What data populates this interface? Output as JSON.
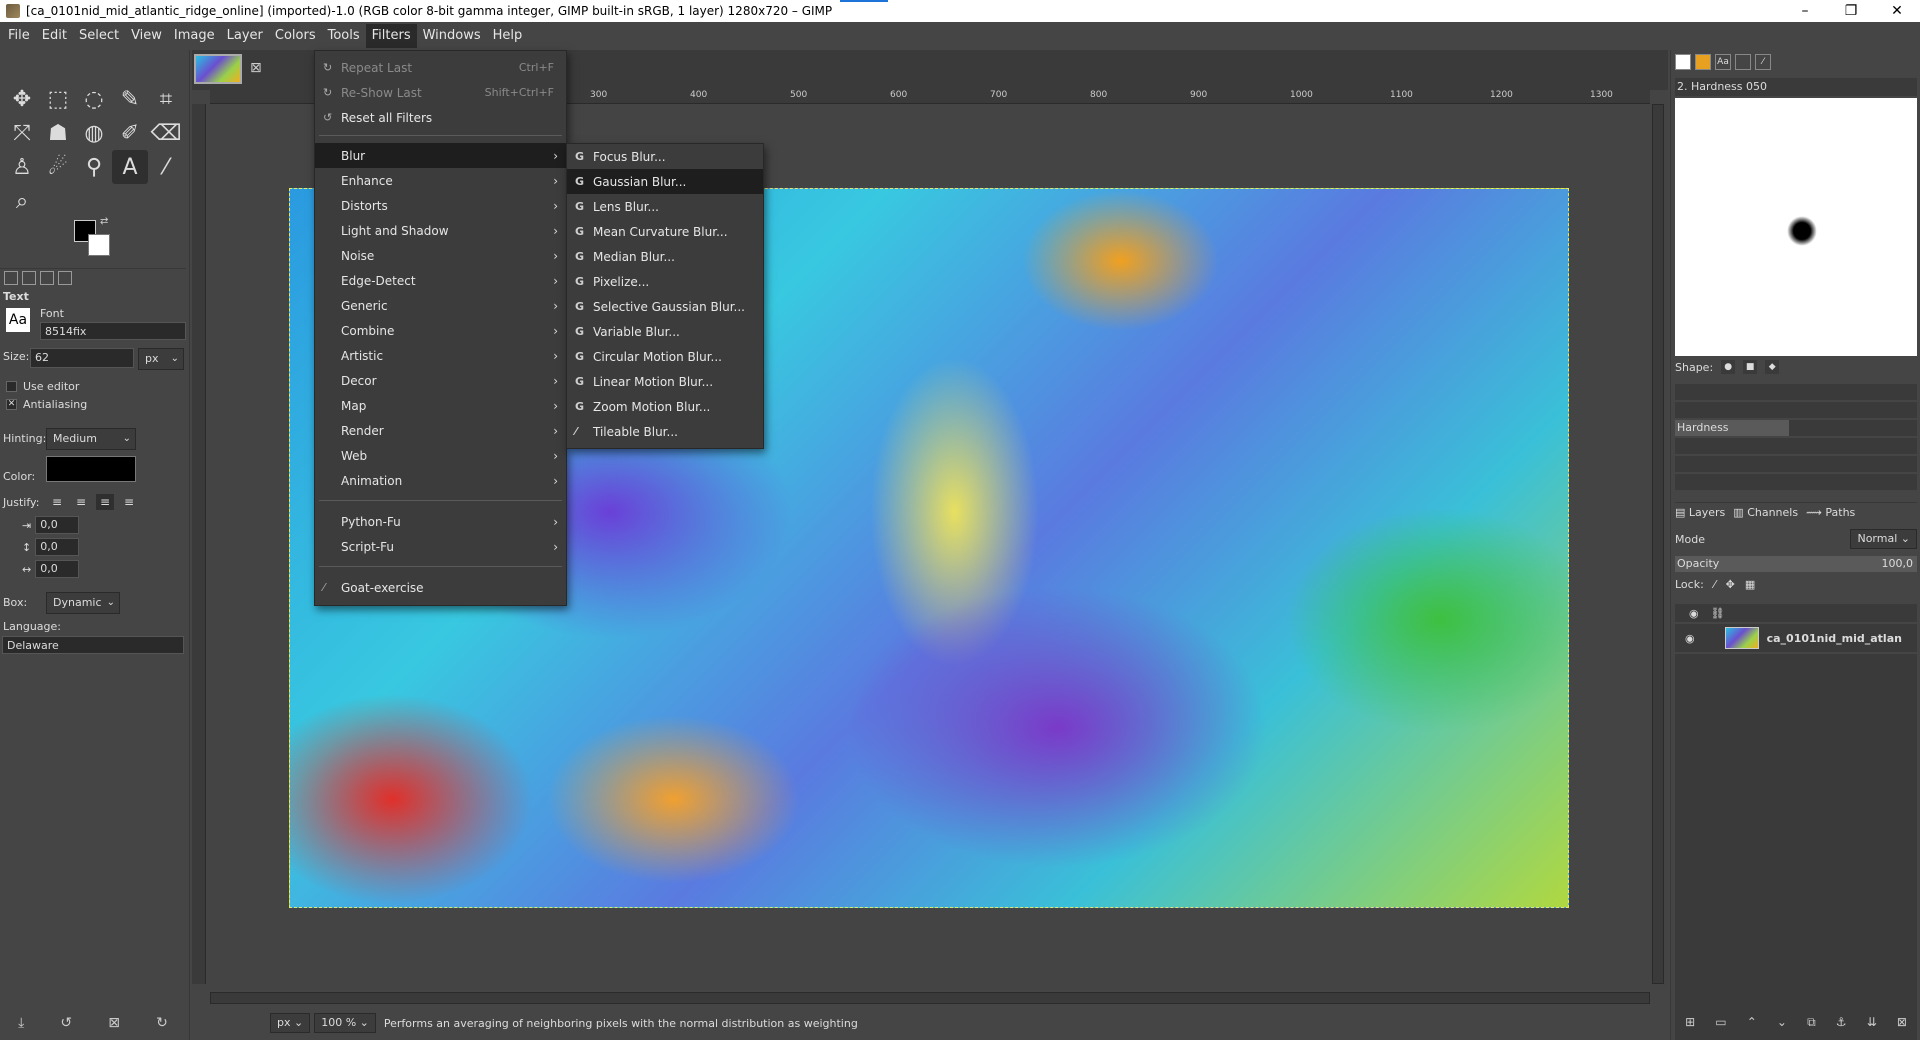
{
  "window": {
    "title": "[ca_0101nid_mid_atlantic_ridge_online] (imported)-1.0 (RGB color 8-bit gamma integer, GIMP built-in sRGB, 1 layer) 1280x720 – GIMP",
    "controls": [
      "–",
      "❐",
      "✕"
    ]
  },
  "menubar": [
    "File",
    "Edit",
    "Select",
    "View",
    "Image",
    "Layer",
    "Colors",
    "Tools",
    "Filters",
    "Windows",
    "Help"
  ],
  "filters_menu": {
    "repeat_last": {
      "label": "Repeat Last",
      "accel": "Ctrl+F"
    },
    "reshow_last": {
      "label": "Re-Show Last",
      "accel": "Shift+Ctrl+F"
    },
    "reset_all": {
      "label": "Reset all Filters"
    },
    "groups": [
      "Blur",
      "Enhance",
      "Distorts",
      "Light and Shadow",
      "Noise",
      "Edge-Detect",
      "Generic",
      "Combine",
      "Artistic",
      "Decor",
      "Map",
      "Render",
      "Web",
      "Animation"
    ],
    "scripts": [
      "Python-Fu",
      "Script-Fu"
    ],
    "goat": "Goat-exercise"
  },
  "blur_menu": [
    "Focus Blur...",
    "Gaussian Blur...",
    "Lens Blur...",
    "Mean Curvature Blur...",
    "Median Blur...",
    "Pixelize...",
    "Selective Gaussian Blur...",
    "Variable Blur...",
    "Circular Motion Blur...",
    "Linear Motion Blur...",
    "Zoom Motion Blur...",
    "Tileable Blur..."
  ],
  "tool_options": {
    "section": "Text",
    "font_label": "Font",
    "font_value": "8514fix",
    "size_label": "Size:",
    "size_value": "62",
    "size_unit": "px",
    "use_editor": "Use editor",
    "antialiasing": "Antialiasing",
    "hinting_label": "Hinting:",
    "hinting_value": "Medium",
    "color_label": "Color:",
    "justify_label": "Justify:",
    "indent": "0,0",
    "line_spacing": "0,0",
    "letter_spacing": "0,0",
    "box_label": "Box:",
    "box_value": "Dynamic",
    "language_label": "Language:",
    "language_value": "Delaware"
  },
  "rulers": {
    "h": [
      "300",
      "400",
      "500",
      "600",
      "700",
      "800",
      "900",
      "1000",
      "1100",
      "1200",
      "1300"
    ]
  },
  "status": {
    "unit": "px",
    "zoom": "100 %",
    "message": "Performs an averaging of neighboring pixels with the normal distribution as weighting"
  },
  "brushes": {
    "name": "2. Hardness 050",
    "shape_label": "Shape:",
    "hardness_label": "Hardness"
  },
  "layers_dock": {
    "tabs": [
      "Layers",
      "Channels",
      "Paths"
    ],
    "mode_label": "Mode",
    "mode_value": "Normal",
    "opacity_label": "Opacity",
    "opacity_value": "100,0",
    "lock_label": "Lock:",
    "layer_name": "ca_0101nid_mid_atlan"
  }
}
